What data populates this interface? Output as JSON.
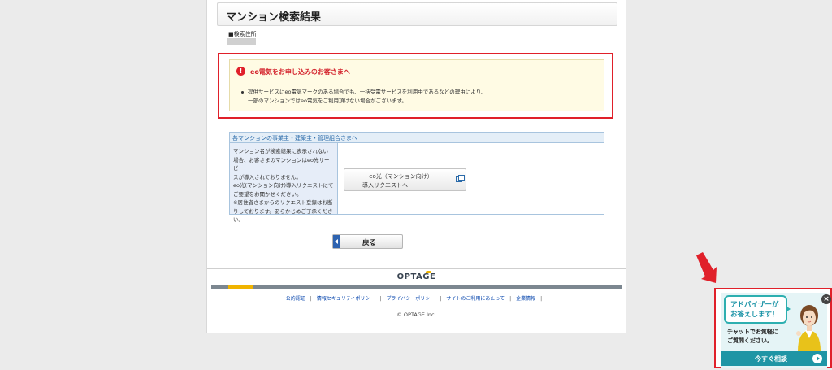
{
  "page": {
    "title": "マンション検索結果",
    "address_label": "■検索住所",
    "address_value": ""
  },
  "notice": {
    "icon": "exclamation-icon",
    "title": "eo電気をお申し込みのお客さまへ",
    "line1": "提供サービスにeo電気マークのある場合でも、一括受電サービスを利用中であるなどの理由により、",
    "line2": "一部のマンションではeo電気をご利用頂けない場合がございます。"
  },
  "owners": {
    "header": "各マンションの事業主・建築主・管理組合さまへ",
    "lines": [
      "マンション名が検索結果に表示されない",
      "場合、お客さまのマンションはeo光サービ",
      "スが導入されておりません。",
      "eo光(マンション向け)導入リクエストにて",
      "ご要望をお聞かせください。",
      "※居住者さまからのリクエスト登録はお断",
      "りしております。あらかじめご了承くださ",
      "い。"
    ],
    "request_button_line1": "eo光（マンション向け）",
    "request_button_line2": "導入リクエストへ"
  },
  "back_button": "戻る",
  "footer": {
    "logo": "OPTAGE",
    "links": [
      "公的認証",
      "情報セキュリティポリシー",
      "プライバシーポリシー",
      "サイトのご利用にあたって",
      "企業情報"
    ],
    "copyright": "© OPTAGE Inc."
  },
  "chat": {
    "bubble_line1": "アドバイザーが",
    "bubble_line2": "お答えします！",
    "sub_line1": "チャットでお気軽に",
    "sub_line2": "ご質問ください。",
    "cta": "今すぐ相談",
    "close": "×"
  },
  "colors": {
    "alert_red": "#e0202a",
    "link_blue": "#0645ad",
    "teal": "#1f95a5",
    "accent_yellow": "#f0b400"
  }
}
